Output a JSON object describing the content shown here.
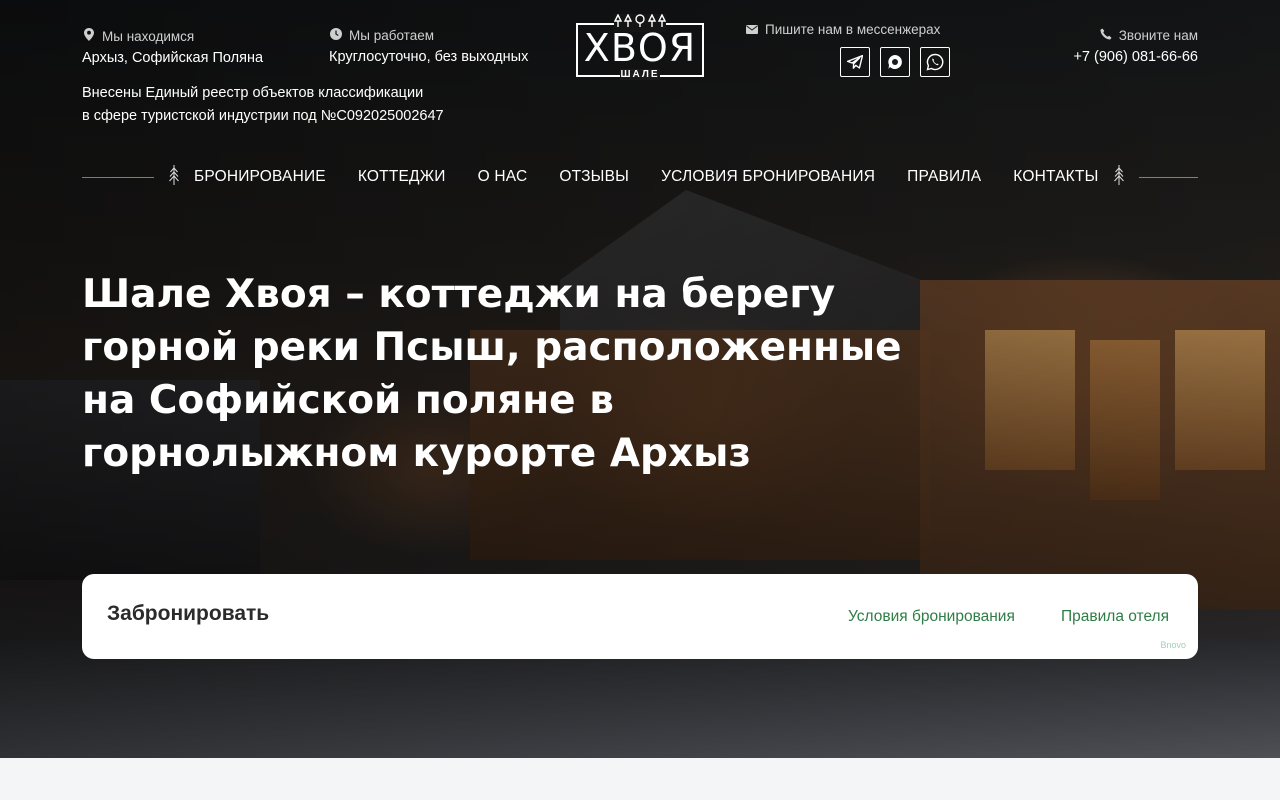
{
  "header": {
    "location_label": "Мы находимся",
    "location_value": "Архыз, Софийская Поляна",
    "hours_label": "Мы работаем",
    "hours_value": "Круглосуточно, без выходных",
    "registry_line1": "Внесены Единый реестр объектов классификации",
    "registry_line2": "в сфере туристской индустрии под №C092025002647",
    "messenger_label": "Пишите нам в мессенжерах",
    "phone_label": "Звоните нам",
    "phone_value": "+7 (906) 081-66-66"
  },
  "logo": {
    "title": "ХВОЯ",
    "subtitle": "ШАЛЕ"
  },
  "icons": {
    "location": "map-pin-icon",
    "hours": "clock-icon",
    "messenger": "mail-icon",
    "phone": "phone-icon",
    "telegram": "telegram-icon",
    "max": "max-messenger-icon",
    "whatsapp": "whatsapp-icon",
    "nav_tree": "pine-tree-icon"
  },
  "nav": {
    "items": [
      "БРОНИРОВАНИЕ",
      "КОТТЕДЖИ",
      "О НАС",
      "ОТЗЫВЫ",
      "УСЛОВИЯ БРОНИРОВАНИЯ",
      "ПРАВИЛА",
      "КОНТАКТЫ"
    ]
  },
  "hero": {
    "headline": "Шале Хвоя – коттеджи на берегу горной реки Псыш, расположенные на Софийской поляне в горнолыжном курорте Архыз"
  },
  "booking": {
    "title": "Забронировать",
    "link_terms": "Условия бронирования",
    "link_rules": "Правила отеля",
    "powered_by": "Bnovo"
  },
  "colors": {
    "accent_green": "#2e7d46",
    "powered_green": "#9ed1b4"
  }
}
